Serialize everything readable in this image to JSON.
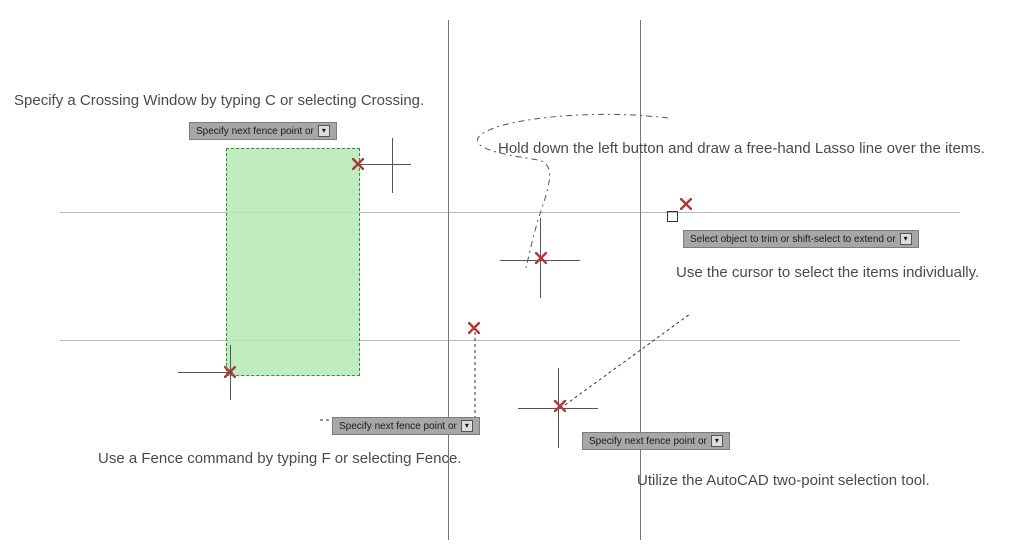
{
  "labels": {
    "crossing": "Specify a Crossing Window by typing C or selecting Crossing.",
    "lasso": "Hold down the left button and draw a free-hand Lasso line over the items.",
    "individual": "Use the cursor to select the items individually.",
    "fence": "Use a Fence command by typing F or selecting Fence.",
    "twopoint": "Utilize the AutoCAD two-point selection tool."
  },
  "tooltips": {
    "fence_prompt": "Specify next fence point or",
    "trim_prompt": "Select object to trim or shift-select to extend or"
  },
  "icons": {
    "x_marker": "x-marker-icon",
    "pickbox": "pickbox-icon",
    "dropdown": "dropdown-glyph-icon"
  },
  "colors": {
    "crossing_fill": "#b6ebb6",
    "crossing_border": "#1a7a1a",
    "grid_line": "#b8b8b8",
    "x_red": "#b33a3a"
  }
}
